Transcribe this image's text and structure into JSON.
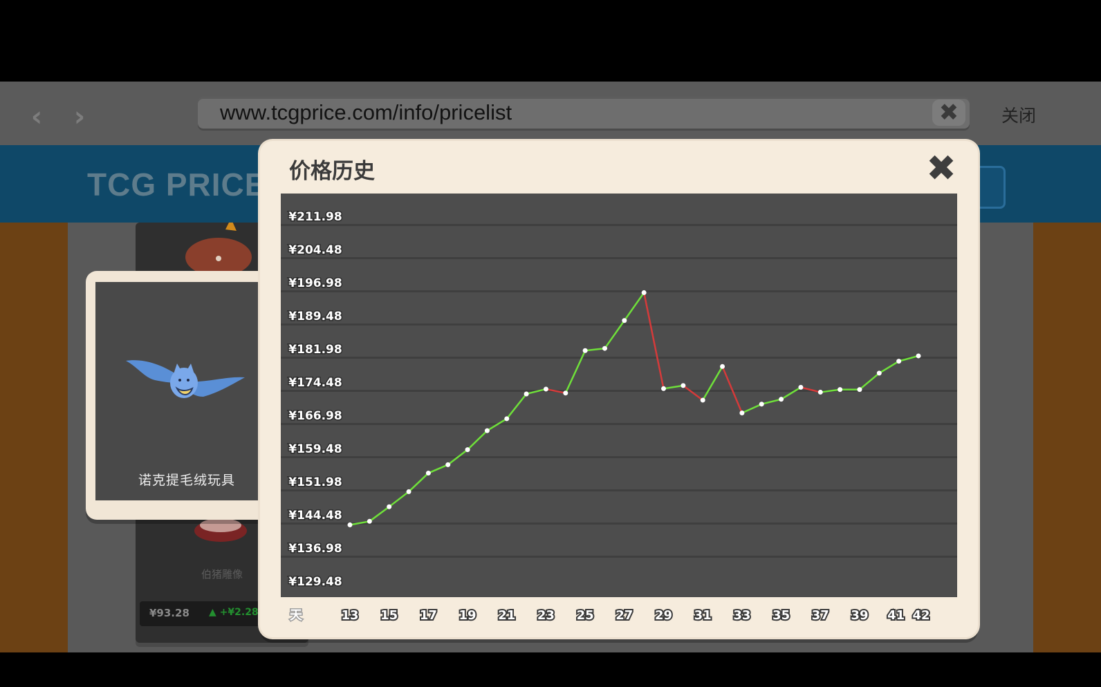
{
  "browser": {
    "back_label": "‹",
    "forward_label": "›",
    "url": "www.tcgprice.com/info/pricelist",
    "clear_label": "✖",
    "close_label": "关闭"
  },
  "site": {
    "logo": "TCG PRICE",
    "bg_card": {
      "name": "伯猪雕像",
      "price": "¥93.28",
      "change": "+¥2.28"
    }
  },
  "item_card": {
    "name": "诺克提毛绒玩具",
    "icon": "bat-icon"
  },
  "modal": {
    "title": "价格历史",
    "close_label": "✖"
  },
  "colors": {
    "up": "#6fe03a",
    "down": "#d53a3a",
    "grid": "#3f3f3f",
    "label": "#ffffff"
  },
  "chart_data": {
    "type": "line",
    "title": "",
    "xlabel": "天",
    "ylabel": "",
    "y_ticks": [
      "¥211.98",
      "¥204.48",
      "¥196.98",
      "¥189.48",
      "¥181.98",
      "¥174.48",
      "¥166.98",
      "¥159.48",
      "¥151.98",
      "¥144.48",
      "¥136.98",
      "¥129.48"
    ],
    "x_ticks": [
      "13",
      "15",
      "17",
      "19",
      "21",
      "23",
      "25",
      "27",
      "29",
      "31",
      "33",
      "35",
      "37",
      "39",
      "41",
      "42"
    ],
    "ylim": [
      129.48,
      211.98
    ],
    "xlim": [
      13,
      42
    ],
    "grid": true,
    "series": [
      {
        "x": [
          13,
          14,
          15,
          16,
          17,
          18,
          19,
          20,
          21,
          22,
          23,
          24,
          25,
          26,
          27,
          28,
          29,
          30,
          31,
          32,
          33,
          34,
          35,
          36,
          37,
          38,
          39,
          40,
          41,
          42
        ],
        "values": [
          144.1,
          144.9,
          148.2,
          151.6,
          155.8,
          157.7,
          161.1,
          165.4,
          168.1,
          173.7,
          174.8,
          173.9,
          183.5,
          184.0,
          190.3,
          196.6,
          174.9,
          175.6,
          172.3,
          179.9,
          169.4,
          171.4,
          172.5,
          175.2,
          174.1,
          174.7,
          174.7,
          178.4,
          181.1,
          182.3
        ]
      }
    ]
  }
}
